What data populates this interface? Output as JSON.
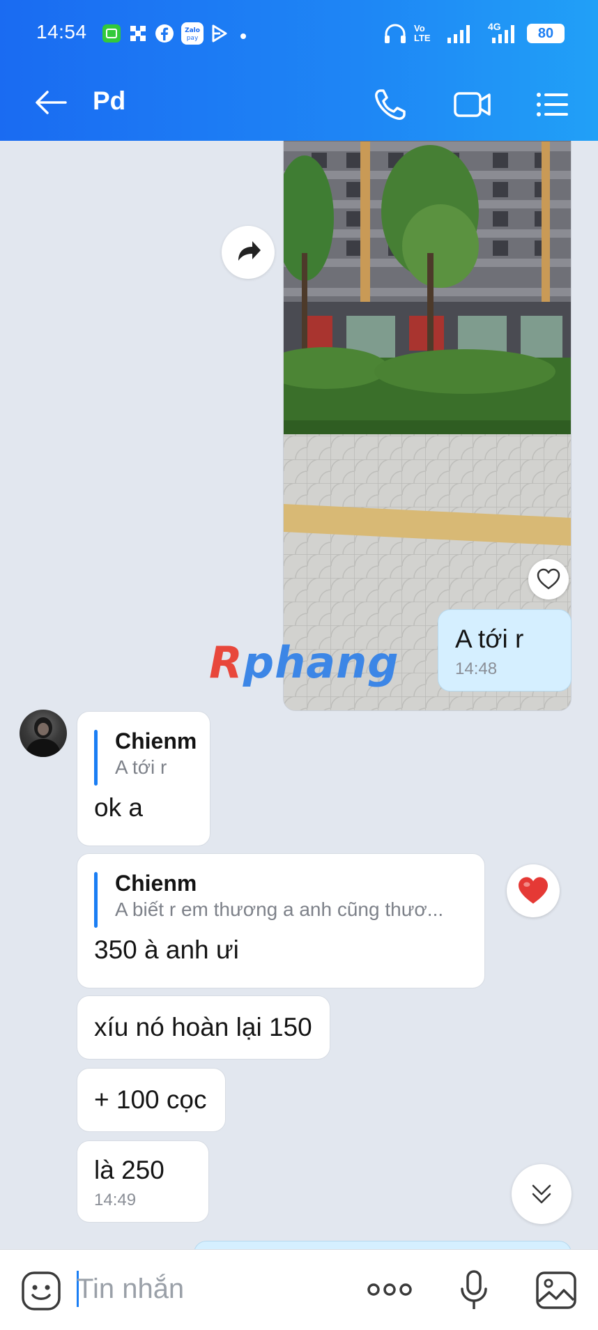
{
  "status_bar": {
    "time": "14:54",
    "network_label": "4G",
    "volte_label": "Vo LTE",
    "battery": "80",
    "icons": [
      "app-icon",
      "grid-icon",
      "facebook-icon",
      "zalopay-icon",
      "play-icon",
      "dot-icon",
      "headphones-icon",
      "signal-icon",
      "battery-icon"
    ]
  },
  "header": {
    "title": "Pd",
    "colors": {
      "gradient_start": "#1a6bf2",
      "gradient_end": "#21a0f7"
    }
  },
  "watermark": {
    "first": "R",
    "rest": "phang"
  },
  "messages": {
    "outgoing_1": {
      "text": "A tới r",
      "time": "14:48"
    },
    "incoming_1": {
      "quote_name": "Chienm",
      "quote_text": "A tới r",
      "text": "ok a"
    },
    "incoming_2": {
      "quote_name": "Chienm",
      "quote_text": "A biết r em thương a anh cũng thươ...",
      "text": "350 à anh ưi"
    },
    "incoming_3": {
      "text": "xíu nó hoàn lại 150"
    },
    "incoming_4": {
      "text": "+ 100 cọc"
    },
    "incoming_5": {
      "text": "là 250",
      "time": "14:49"
    }
  },
  "input": {
    "placeholder": "Tin nhắn",
    "icons": [
      "sticker-icon",
      "more-icon",
      "microphone-icon",
      "image-icon"
    ]
  },
  "colors": {
    "chat_background": "#e2e7ef",
    "outgoing_bubble": "#d5efff",
    "incoming_bubble": "#ffffff",
    "accent": "#1a7ef4",
    "heart_red": "#e53935"
  }
}
